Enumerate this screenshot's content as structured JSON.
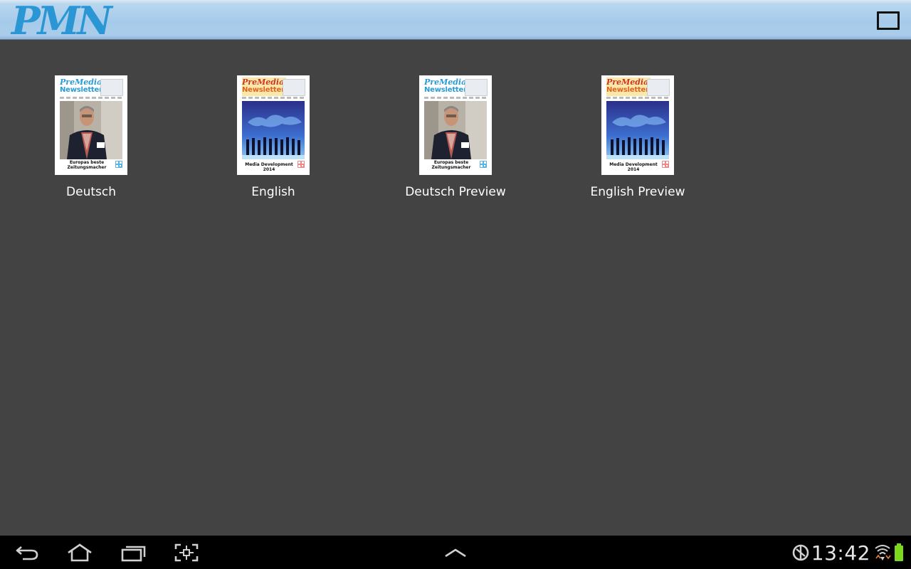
{
  "header": {
    "logo_text": "PMN",
    "menu_icon": "square-outline-icon"
  },
  "tiles": [
    {
      "label": "Deutsch",
      "cover": {
        "masthead_line1": "PreMedia",
        "masthead_line2": "Newsletter",
        "footer": "Europas beste Zeitungsmacher",
        "variant": "de"
      }
    },
    {
      "label": "English",
      "cover": {
        "masthead_line1": "PreMedia",
        "masthead_line2": "Newsletter",
        "footer": "Media Development 2014",
        "variant": "en"
      }
    },
    {
      "label": "Deutsch Preview",
      "cover": {
        "masthead_line1": "PreMedia",
        "masthead_line2": "Newsletter",
        "footer": "Europas beste Zeitungsmacher",
        "variant": "de"
      }
    },
    {
      "label": "English Preview",
      "cover": {
        "masthead_line1": "PreMedia",
        "masthead_line2": "Newsletter",
        "footer": "Media Development 2014",
        "variant": "en"
      }
    }
  ],
  "navbar": {
    "icons": [
      "back-icon",
      "home-icon",
      "recent-apps-icon",
      "screenshot-icon",
      "up-chevron-icon",
      "sync-icon",
      "wifi-icon",
      "battery-icon"
    ],
    "time": "13:42"
  },
  "colors": {
    "header_blue": "#a6cbea",
    "logo_blue": "#2b96d4",
    "background": "#434343",
    "navbar": "#000000",
    "battery": "#7cd81f"
  }
}
